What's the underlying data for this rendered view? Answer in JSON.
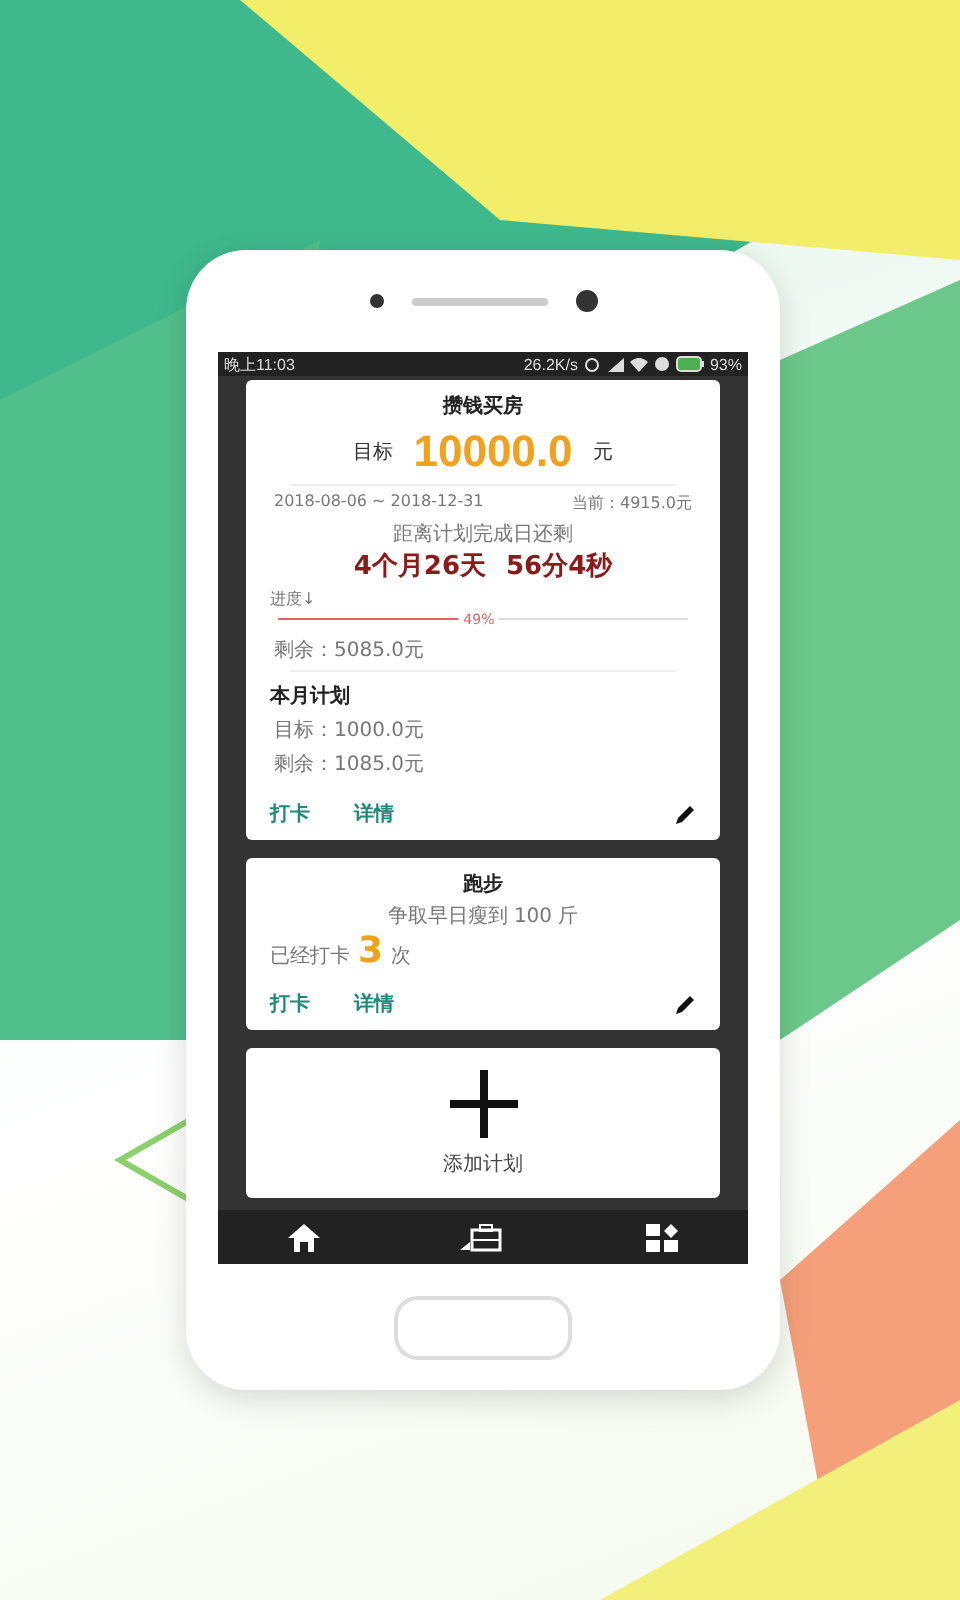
{
  "status_bar": {
    "time": "晚上11:03",
    "speed": "26.2K/s",
    "battery": "93%"
  },
  "plans": [
    {
      "kind": "savings",
      "title": "攒钱买房",
      "target_label": "目标",
      "target": "10000.0",
      "unit": "元",
      "date_range": "2018-08-06 ~ 2018-12-31",
      "current": "当前：4915.0元",
      "countdown_label": "距离计划完成日还剩",
      "countdown": [
        "4个月26天",
        "56分4秒"
      ],
      "progress_label": "进度↓",
      "level": 0.49,
      "progress_text": "49%",
      "remaining": "剩余：5085.0元",
      "month_title": "本月计划",
      "month_target": "目标：1000.0元",
      "month_remaining": "剩余：1085.0元",
      "actions": [
        "打卡",
        "详情"
      ]
    },
    {
      "kind": "checkin",
      "title": "跑步",
      "subtitle": "争取早日瘦到 100 斤",
      "count_prefix": "已经打卡",
      "count": "3",
      "count_suffix": "次",
      "actions": [
        "打卡",
        "详情"
      ]
    }
  ],
  "add_card": {
    "label": "添加计划"
  }
}
